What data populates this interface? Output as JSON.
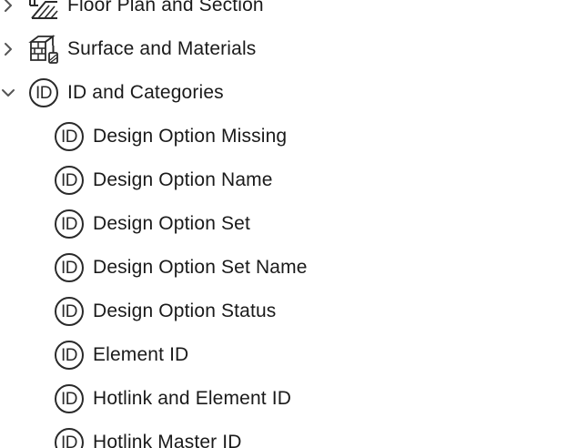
{
  "tree": {
    "groups": [
      {
        "label": "Floor Plan and Section",
        "expanded": false,
        "icon": "floor-plan-section-icon"
      },
      {
        "label": "Surface and Materials",
        "expanded": false,
        "icon": "surface-materials-icon"
      },
      {
        "label": "ID and Categories",
        "expanded": true,
        "icon": "id-icon",
        "icon_text": "ID"
      }
    ],
    "children": [
      {
        "label": "Design Option Missing",
        "icon_text": "ID"
      },
      {
        "label": "Design Option Name",
        "icon_text": "ID"
      },
      {
        "label": "Design Option Set",
        "icon_text": "ID"
      },
      {
        "label": "Design Option Set Name",
        "icon_text": "ID"
      },
      {
        "label": "Design Option Status",
        "icon_text": "ID"
      },
      {
        "label": "Element ID",
        "icon_text": "ID"
      },
      {
        "label": "Hotlink and Element ID",
        "icon_text": "ID"
      },
      {
        "label": "Hotlink Master ID",
        "icon_text": "ID"
      }
    ]
  }
}
